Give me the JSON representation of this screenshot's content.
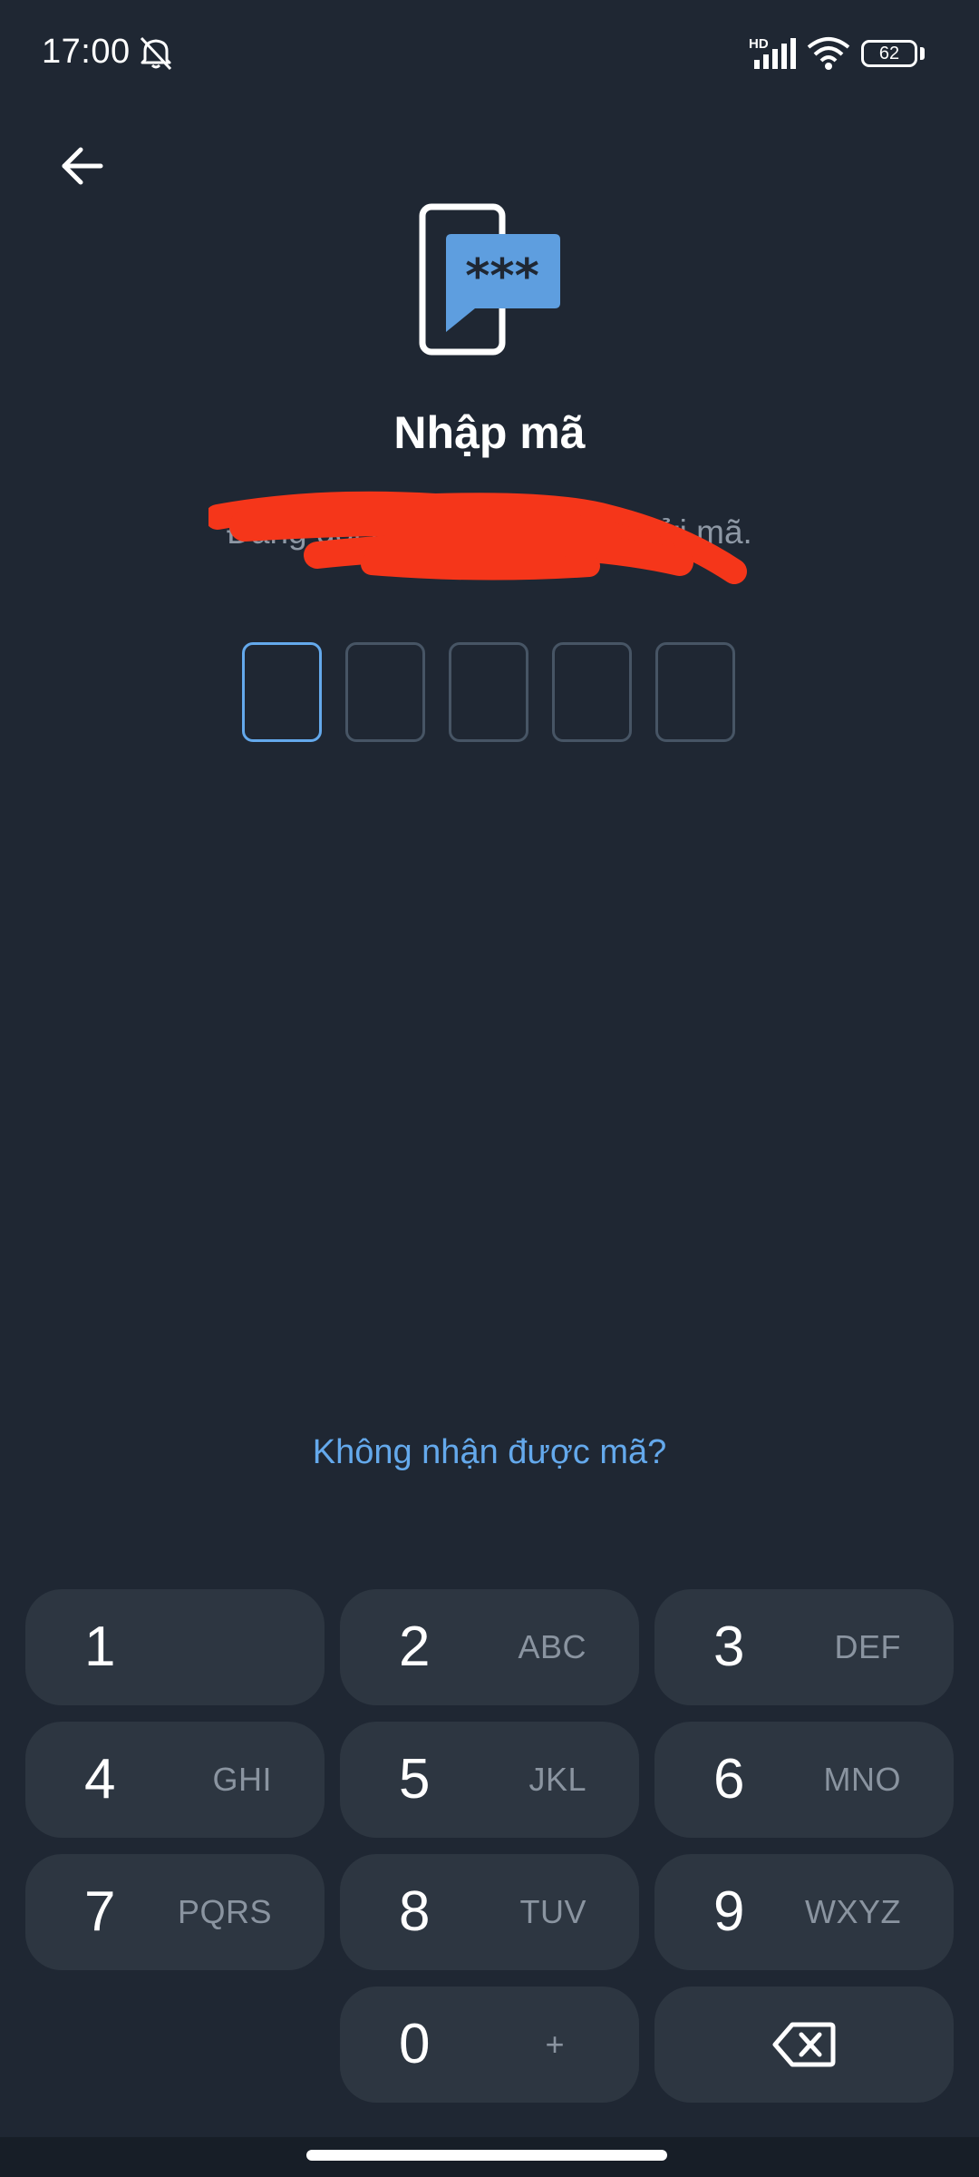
{
  "status_bar": {
    "time": "17:00",
    "network_badge": "HD",
    "battery_level": "62",
    "icons": [
      "mute-icon",
      "signal-icon",
      "wifi-icon",
      "battery-icon"
    ]
  },
  "header": {
    "back_icon": "arrow-left-icon"
  },
  "illustration_icon": "phone-sms-code-icon",
  "title": "Nhập mã",
  "subtitle": "Đang gọi tới số của bạn để gửi mã.",
  "code": {
    "length": 5,
    "values": [
      "",
      "",
      "",
      "",
      ""
    ]
  },
  "resend_link": "Không nhận được mã?",
  "keypad": {
    "keys": [
      {
        "digit": "1",
        "letters": ""
      },
      {
        "digit": "2",
        "letters": "ABC"
      },
      {
        "digit": "3",
        "letters": "DEF"
      },
      {
        "digit": "4",
        "letters": "GHI"
      },
      {
        "digit": "5",
        "letters": "JKL"
      },
      {
        "digit": "6",
        "letters": "MNO"
      },
      {
        "digit": "7",
        "letters": "PQRS"
      },
      {
        "digit": "8",
        "letters": "TUV"
      },
      {
        "digit": "9",
        "letters": "WXYZ"
      },
      {
        "digit": "0",
        "letters": "+"
      }
    ],
    "backspace_icon": "backspace-icon"
  },
  "colors": {
    "background": "#1f2733",
    "key_background": "#2d3641",
    "accent": "#64a9ec",
    "muted_text": "#8e98a5",
    "redaction": "#f5361a"
  }
}
